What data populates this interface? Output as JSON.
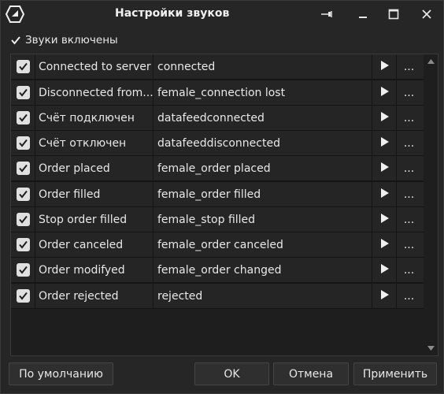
{
  "window": {
    "title": "Настройки звуков",
    "logo_icon": "app-logo-icon",
    "pin_icon": "pin-icon",
    "minimize_icon": "minimize-icon",
    "maximize_icon": "maximize-icon",
    "close_icon": "close-icon"
  },
  "sounds_enabled": {
    "label": "Звуки включены",
    "checked": true
  },
  "sounds": [
    {
      "event": "Connected to server",
      "file": "connected",
      "checked": true
    },
    {
      "event": "Disconnected from...",
      "file": "female_connection lost",
      "checked": true
    },
    {
      "event": "Счёт подключен",
      "file": "datafeedconnected",
      "checked": true
    },
    {
      "event": "Счёт отключен",
      "file": "datafeeddisconnected",
      "checked": true
    },
    {
      "event": "Order placed",
      "file": "female_order placed",
      "checked": true
    },
    {
      "event": "Order filled",
      "file": "female_order filled",
      "checked": true
    },
    {
      "event": "Stop order filled",
      "file": "female_stop filled",
      "checked": true
    },
    {
      "event": "Order canceled",
      "file": "female_order canceled",
      "checked": true
    },
    {
      "event": "Order modifyed",
      "file": "female_order changed",
      "checked": true
    },
    {
      "event": "Order rejected",
      "file": "rejected",
      "checked": true
    }
  ],
  "row_actions": {
    "play_icon": "play-icon",
    "more_label": "..."
  },
  "buttons": {
    "default_label": "По умолчанию",
    "ok_label": "OK",
    "cancel_label": "Отмена",
    "apply_label": "Применить"
  }
}
